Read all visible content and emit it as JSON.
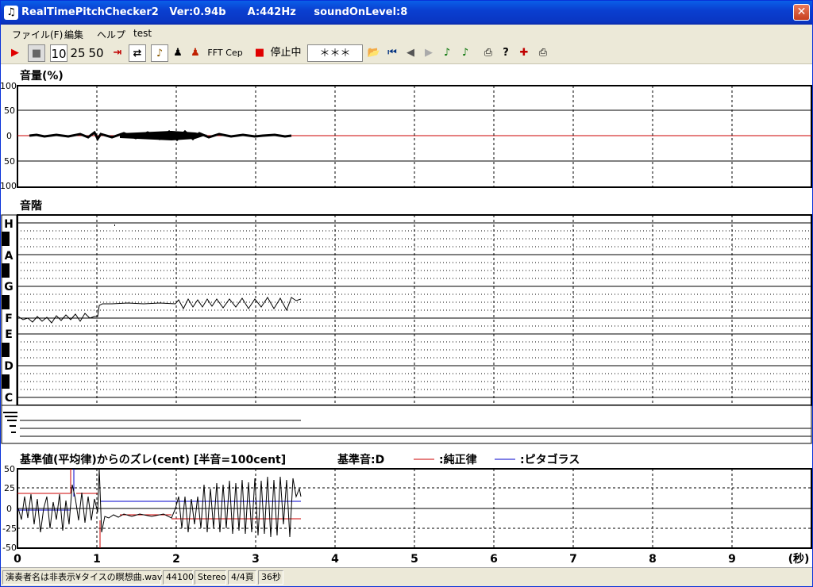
{
  "window": {
    "title": "RealTimePitchChecker2   Ver:0.94b      A:442Hz     soundOnLevel:8",
    "close_label": "✕"
  },
  "menu": [
    "ファイル(F)",
    "編集",
    "ヘルプ",
    "test"
  ],
  "toolbar": {
    "play_icon": "▶",
    "stop_icon": "■",
    "scale_options": [
      "10",
      "25",
      "50"
    ],
    "cep_label": "Cep",
    "fft_label": "FFT",
    "status_label": "停止中",
    "note_display": "＊＊＊"
  },
  "volume_panel": {
    "title": "音量(%)",
    "y_ticks": [
      "100",
      "50",
      "0",
      "50",
      "100"
    ]
  },
  "pitch_panel": {
    "title": "音階",
    "notes": [
      "H",
      "A",
      "G",
      "F",
      "E",
      "D",
      "C"
    ]
  },
  "deviation_panel": {
    "title": "基準値(平均律)からのズレ(cent) [半音=100cent]",
    "base_note": "基準音:D",
    "legend_just": ":純正律",
    "legend_pythagorean": ":ピタゴラス",
    "y_ticks": [
      "50",
      "25",
      "0",
      "-25",
      "-50"
    ],
    "colors": {
      "just": "#cc0000",
      "pythagorean": "#0000cc"
    }
  },
  "time_axis": {
    "ticks": [
      "0",
      "1",
      "2",
      "3",
      "4",
      "5",
      "6",
      "7",
      "8",
      "9"
    ],
    "unit_label": "(秒)"
  },
  "statusbar": {
    "file": "演奏者名は非表示¥タイスの瞑想曲.wav",
    "sample_rate": "44100",
    "channels": "Stereo",
    "page": "4/4頁",
    "duration": "36秒"
  }
}
